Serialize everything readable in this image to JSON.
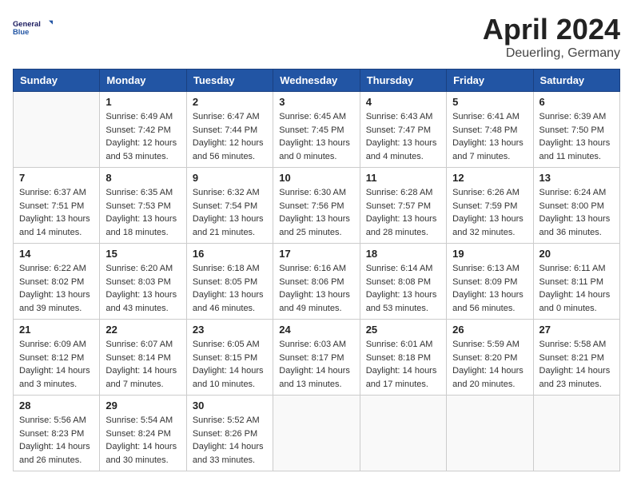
{
  "header": {
    "logo_text_top": "General",
    "logo_text_bottom": "Blue",
    "title": "April 2024",
    "subtitle": "Deuerling, Germany"
  },
  "calendar": {
    "days_of_week": [
      "Sunday",
      "Monday",
      "Tuesday",
      "Wednesday",
      "Thursday",
      "Friday",
      "Saturday"
    ],
    "weeks": [
      [
        {
          "day": "",
          "info": ""
        },
        {
          "day": "1",
          "info": "Sunrise: 6:49 AM\nSunset: 7:42 PM\nDaylight: 12 hours\nand 53 minutes."
        },
        {
          "day": "2",
          "info": "Sunrise: 6:47 AM\nSunset: 7:44 PM\nDaylight: 12 hours\nand 56 minutes."
        },
        {
          "day": "3",
          "info": "Sunrise: 6:45 AM\nSunset: 7:45 PM\nDaylight: 13 hours\nand 0 minutes."
        },
        {
          "day": "4",
          "info": "Sunrise: 6:43 AM\nSunset: 7:47 PM\nDaylight: 13 hours\nand 4 minutes."
        },
        {
          "day": "5",
          "info": "Sunrise: 6:41 AM\nSunset: 7:48 PM\nDaylight: 13 hours\nand 7 minutes."
        },
        {
          "day": "6",
          "info": "Sunrise: 6:39 AM\nSunset: 7:50 PM\nDaylight: 13 hours\nand 11 minutes."
        }
      ],
      [
        {
          "day": "7",
          "info": "Sunrise: 6:37 AM\nSunset: 7:51 PM\nDaylight: 13 hours\nand 14 minutes."
        },
        {
          "day": "8",
          "info": "Sunrise: 6:35 AM\nSunset: 7:53 PM\nDaylight: 13 hours\nand 18 minutes."
        },
        {
          "day": "9",
          "info": "Sunrise: 6:32 AM\nSunset: 7:54 PM\nDaylight: 13 hours\nand 21 minutes."
        },
        {
          "day": "10",
          "info": "Sunrise: 6:30 AM\nSunset: 7:56 PM\nDaylight: 13 hours\nand 25 minutes."
        },
        {
          "day": "11",
          "info": "Sunrise: 6:28 AM\nSunset: 7:57 PM\nDaylight: 13 hours\nand 28 minutes."
        },
        {
          "day": "12",
          "info": "Sunrise: 6:26 AM\nSunset: 7:59 PM\nDaylight: 13 hours\nand 32 minutes."
        },
        {
          "day": "13",
          "info": "Sunrise: 6:24 AM\nSunset: 8:00 PM\nDaylight: 13 hours\nand 36 minutes."
        }
      ],
      [
        {
          "day": "14",
          "info": "Sunrise: 6:22 AM\nSunset: 8:02 PM\nDaylight: 13 hours\nand 39 minutes."
        },
        {
          "day": "15",
          "info": "Sunrise: 6:20 AM\nSunset: 8:03 PM\nDaylight: 13 hours\nand 43 minutes."
        },
        {
          "day": "16",
          "info": "Sunrise: 6:18 AM\nSunset: 8:05 PM\nDaylight: 13 hours\nand 46 minutes."
        },
        {
          "day": "17",
          "info": "Sunrise: 6:16 AM\nSunset: 8:06 PM\nDaylight: 13 hours\nand 49 minutes."
        },
        {
          "day": "18",
          "info": "Sunrise: 6:14 AM\nSunset: 8:08 PM\nDaylight: 13 hours\nand 53 minutes."
        },
        {
          "day": "19",
          "info": "Sunrise: 6:13 AM\nSunset: 8:09 PM\nDaylight: 13 hours\nand 56 minutes."
        },
        {
          "day": "20",
          "info": "Sunrise: 6:11 AM\nSunset: 8:11 PM\nDaylight: 14 hours\nand 0 minutes."
        }
      ],
      [
        {
          "day": "21",
          "info": "Sunrise: 6:09 AM\nSunset: 8:12 PM\nDaylight: 14 hours\nand 3 minutes."
        },
        {
          "day": "22",
          "info": "Sunrise: 6:07 AM\nSunset: 8:14 PM\nDaylight: 14 hours\nand 7 minutes."
        },
        {
          "day": "23",
          "info": "Sunrise: 6:05 AM\nSunset: 8:15 PM\nDaylight: 14 hours\nand 10 minutes."
        },
        {
          "day": "24",
          "info": "Sunrise: 6:03 AM\nSunset: 8:17 PM\nDaylight: 14 hours\nand 13 minutes."
        },
        {
          "day": "25",
          "info": "Sunrise: 6:01 AM\nSunset: 8:18 PM\nDaylight: 14 hours\nand 17 minutes."
        },
        {
          "day": "26",
          "info": "Sunrise: 5:59 AM\nSunset: 8:20 PM\nDaylight: 14 hours\nand 20 minutes."
        },
        {
          "day": "27",
          "info": "Sunrise: 5:58 AM\nSunset: 8:21 PM\nDaylight: 14 hours\nand 23 minutes."
        }
      ],
      [
        {
          "day": "28",
          "info": "Sunrise: 5:56 AM\nSunset: 8:23 PM\nDaylight: 14 hours\nand 26 minutes."
        },
        {
          "day": "29",
          "info": "Sunrise: 5:54 AM\nSunset: 8:24 PM\nDaylight: 14 hours\nand 30 minutes."
        },
        {
          "day": "30",
          "info": "Sunrise: 5:52 AM\nSunset: 8:26 PM\nDaylight: 14 hours\nand 33 minutes."
        },
        {
          "day": "",
          "info": ""
        },
        {
          "day": "",
          "info": ""
        },
        {
          "day": "",
          "info": ""
        },
        {
          "day": "",
          "info": ""
        }
      ]
    ]
  }
}
